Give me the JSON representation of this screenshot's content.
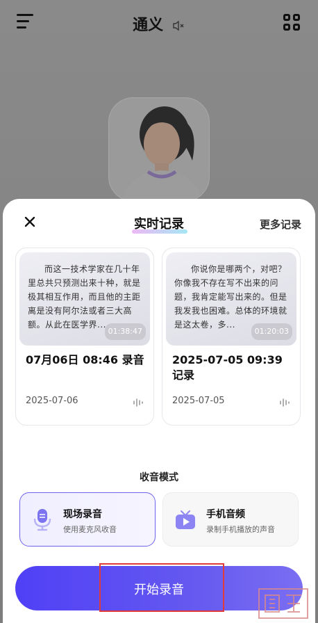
{
  "header": {
    "title": "通义"
  },
  "sheet": {
    "title": "实时记录",
    "more_label": "更多记录",
    "cards": [
      {
        "preview": "而这一技术学家在几十年里总共只预测出来十种，就是极其相互作用，而且他的主距离是没有阿尔法或者三大高额。从此在医学界...",
        "duration": "01:38:47",
        "title": "07月06日 08:46 录音",
        "date": "2025-07-06"
      },
      {
        "preview": "你说你是哪两个，对吧？你像我不存在写不出来的问题，我肯定能写出来的。但是我发我也困难。总体的环境就是这太卷，多...",
        "duration": "01:20:03",
        "title": "2025-07-05 09:39 记录",
        "date": "2025-07-05"
      }
    ],
    "mode_label": "收音模式",
    "modes": [
      {
        "title": "现场录音",
        "subtitle": "使用麦克风收音",
        "icon": "microphone-icon",
        "selected": true
      },
      {
        "title": "手机音频",
        "subtitle": "录制手机播放的声音",
        "icon": "tv-play-icon",
        "selected": false
      }
    ],
    "start_label": "开始录音"
  },
  "colors": {
    "accent": "#5a4ef5",
    "highlight": "#e03a3a"
  }
}
